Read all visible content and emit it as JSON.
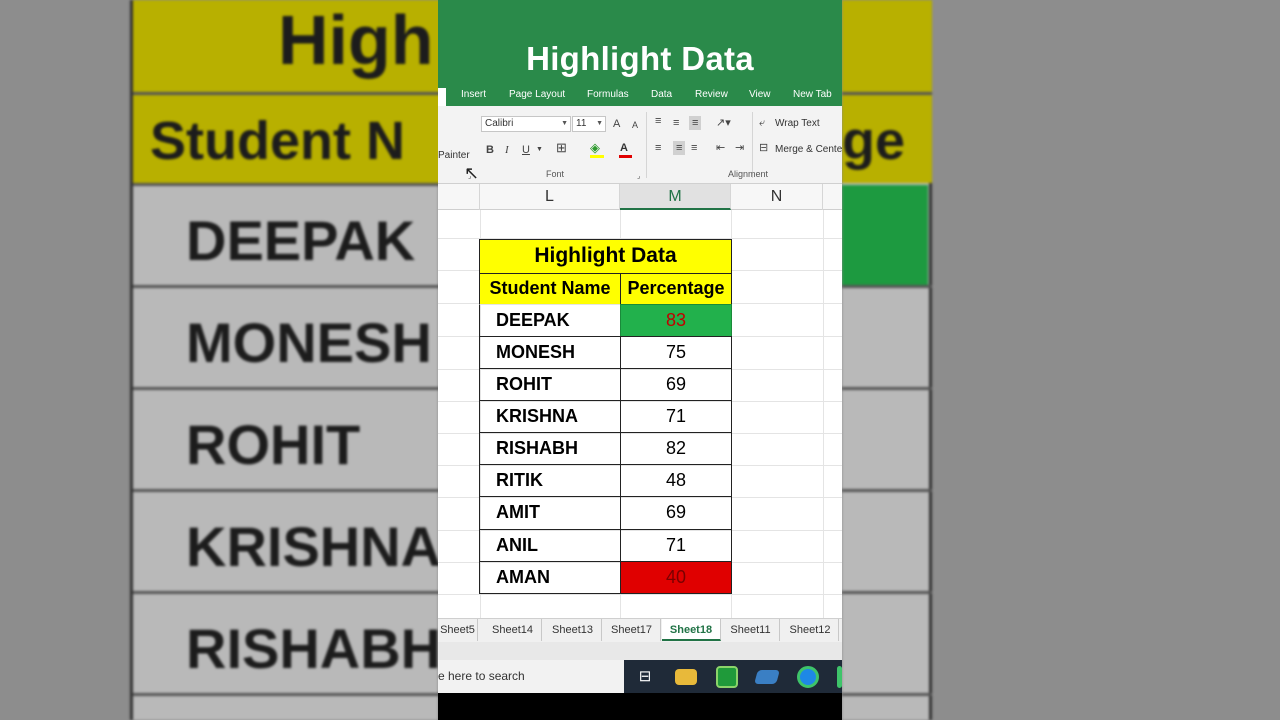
{
  "app": {
    "title": "Highlight Data",
    "menu": [
      "Insert",
      "Page Layout",
      "Formulas",
      "Data",
      "Review",
      "View",
      "New Tab"
    ]
  },
  "ribbon": {
    "painter_label": "Painter",
    "font_name": "Calibri",
    "font_size": "11",
    "grow_font": "A",
    "shrink_font": "A",
    "bold": "B",
    "italic": "I",
    "underline": "U",
    "wrap_text": "Wrap Text",
    "merge_center": "Merge & Cente",
    "group_font": "Font",
    "group_alignment": "Alignment"
  },
  "columns": [
    "L",
    "M",
    "N"
  ],
  "table": {
    "title": "Highlight Data",
    "headers": [
      "Student Name",
      "Percentage"
    ],
    "rows": [
      {
        "name": "DEEPAK",
        "pct": "83"
      },
      {
        "name": "MONESH",
        "pct": "75"
      },
      {
        "name": "ROHIT",
        "pct": "69"
      },
      {
        "name": "KRISHNA",
        "pct": "71"
      },
      {
        "name": "RISHABH",
        "pct": "82"
      },
      {
        "name": "RITIK",
        "pct": "48"
      },
      {
        "name": "AMIT",
        "pct": "69"
      },
      {
        "name": "ANIL",
        "pct": "71"
      },
      {
        "name": "AMAN",
        "pct": "40"
      }
    ],
    "highlight_max_color": "#22b14c",
    "highlight_min_color": "#e00000",
    "header_fill": "#ffff00"
  },
  "sheets": [
    "Sheet5",
    "Sheet14",
    "Sheet13",
    "Sheet17",
    "Sheet18",
    "Sheet11",
    "Sheet12"
  ],
  "active_sheet": "Sheet18",
  "taskbar": {
    "search_text": "e here to search",
    "icons": [
      "task-view-icon",
      "file-explorer-icon",
      "camtasia-icon",
      "app-icon",
      "edge-icon"
    ]
  },
  "background": {
    "title_fragment": "High",
    "header_fragment": "Student N",
    "header_right_fragment": "ge",
    "names": [
      "DEEPAK",
      "MONESH",
      "ROHIT",
      "KRISHNA",
      "RISHABH"
    ]
  },
  "colors": {
    "title_bar": "#2a8a4a",
    "excel_green": "#217346"
  }
}
